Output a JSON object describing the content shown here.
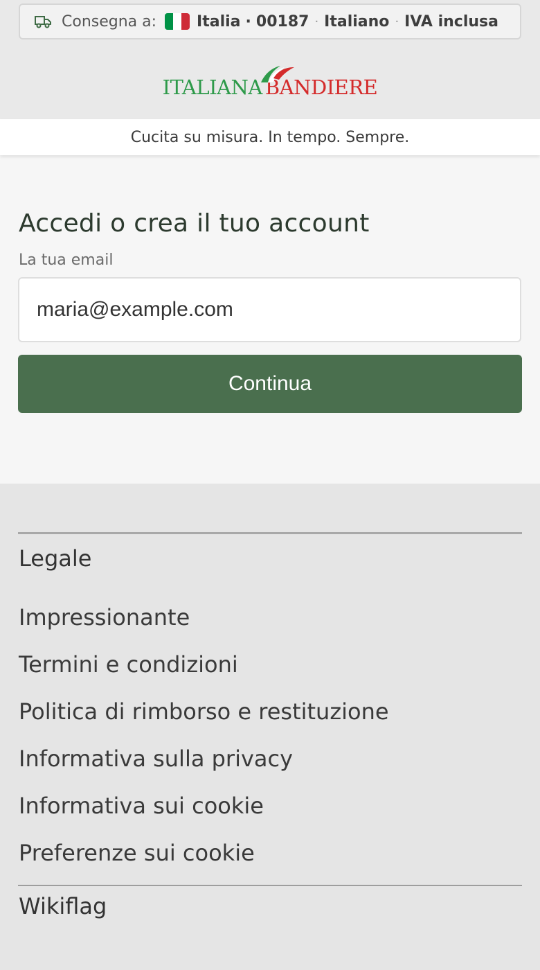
{
  "delivery_bar": {
    "label": "Consegna a:",
    "country": "Italia",
    "dot": "·",
    "postcode": "00187",
    "language": "Italiano",
    "vat": "IVA inclusa",
    "flag_colors": [
      "#009246",
      "#ffffff",
      "#ce2b37"
    ]
  },
  "logo": {
    "part1": "ITALIANA",
    "part2": "BANDIERE"
  },
  "tagline": "Cucita su misura. In tempo. Sempre.",
  "login": {
    "title": "Accedi o crea il tuo account",
    "email_label": "La tua email",
    "email_value": "maria@example.com",
    "continue_label": "Continua"
  },
  "footer": {
    "legal_heading": "Legale",
    "legal_links": [
      "Impressionante",
      "Termini e condizioni",
      "Politica di rimborso e restituzione",
      "Informativa sulla privacy",
      "Informativa sui cookie",
      "Preferenze sui cookie"
    ],
    "wiki_heading": "Wikiflag"
  },
  "colors": {
    "primary_button": "#4a6f4e",
    "logo_green": "#2e9a4a",
    "logo_red": "#d42b2b"
  }
}
